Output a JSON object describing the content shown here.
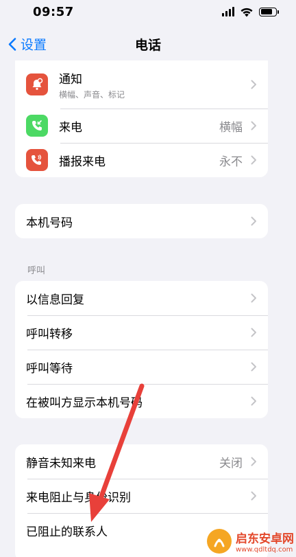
{
  "status_bar": {
    "time": "09:57"
  },
  "nav": {
    "back_label": "设置",
    "title": "电话"
  },
  "group1": {
    "items": [
      {
        "label": "通知",
        "sub": "横幅、声音、标记",
        "value": "",
        "icon": "bell-badge-icon",
        "icon_color": "#e5533d"
      },
      {
        "label": "来电",
        "sub": "",
        "value": "横幅",
        "icon": "incoming-call-icon",
        "icon_color": "#4cd964"
      },
      {
        "label": "播报来电",
        "sub": "",
        "value": "永不",
        "icon": "announce-call-icon",
        "icon_color": "#e5533d"
      }
    ]
  },
  "group2": {
    "items": [
      {
        "label": "本机号码"
      }
    ]
  },
  "section_calls": {
    "header": "呼叫"
  },
  "group3": {
    "items": [
      {
        "label": "以信息回复"
      },
      {
        "label": "呼叫转移"
      },
      {
        "label": "呼叫等待"
      },
      {
        "label": "在被叫方显示本机号码"
      }
    ]
  },
  "group4": {
    "items": [
      {
        "label": "静音未知来电",
        "value": "关闭"
      },
      {
        "label": "来电阻止与身份识别",
        "value": ""
      },
      {
        "label": "已阻止的联系人",
        "value": ""
      }
    ]
  },
  "watermark": {
    "title": "启东安卓网",
    "sub": "www.qdltdq.com"
  },
  "colors": {
    "accent": "#0a7aff",
    "arrow": "#e8403a"
  }
}
